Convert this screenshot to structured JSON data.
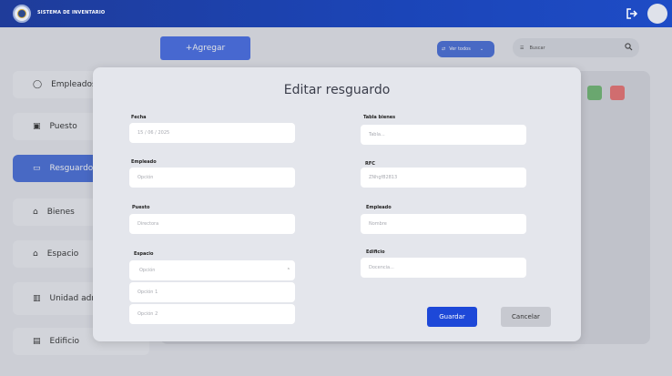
{
  "header": {
    "app_title": "SISTEMA DE INVENTARIO",
    "logout_icon": "logout-icon",
    "avatar_icon": "avatar"
  },
  "toolbar": {
    "add_label": "+Agregar",
    "view_select": "Ver todos",
    "search_placeholder": "Buscar"
  },
  "sidebar": {
    "items": [
      {
        "label": "Empleados",
        "icon": "person-icon"
      },
      {
        "label": "Puesto",
        "icon": "id-card-icon"
      },
      {
        "label": "Resguardos",
        "icon": "folder-icon",
        "active": true
      },
      {
        "label": "Bienes",
        "icon": "bag-icon"
      },
      {
        "label": "Espacio",
        "icon": "home-icon"
      },
      {
        "label": "Unidad administrativa",
        "icon": "building-icon"
      },
      {
        "label": "Edificio",
        "icon": "office-icon"
      }
    ]
  },
  "modal": {
    "title": "Editar resguardo",
    "left": {
      "fecha_label": "Fecha",
      "fecha_value": "15 / 06 / 2025",
      "empleado_label": "Empleado",
      "empleado_value": "Opción",
      "puesto_label": "Puesto",
      "puesto_value": "Directora",
      "espacio_label": "Espacio",
      "espacio_value": "Opción",
      "espacio_options": [
        "Opción 1",
        "Opción 2"
      ]
    },
    "right": {
      "tabla_label": "Tabla bienes",
      "tabla_value": "Tabla...",
      "rfc_label": "RFC",
      "rfc_value": "ZNhgf82813",
      "empleado_label": "Empleado",
      "empleado_value": "Nombre",
      "edificio_label": "Edificio",
      "edificio_value": "Docencia..."
    },
    "save_label": "Guardar",
    "cancel_label": "Cancelar"
  },
  "colors": {
    "primary": "#1d48d8",
    "header": "#1e3fa8",
    "edit": "#67b46a",
    "delete": "#e96a6a"
  }
}
